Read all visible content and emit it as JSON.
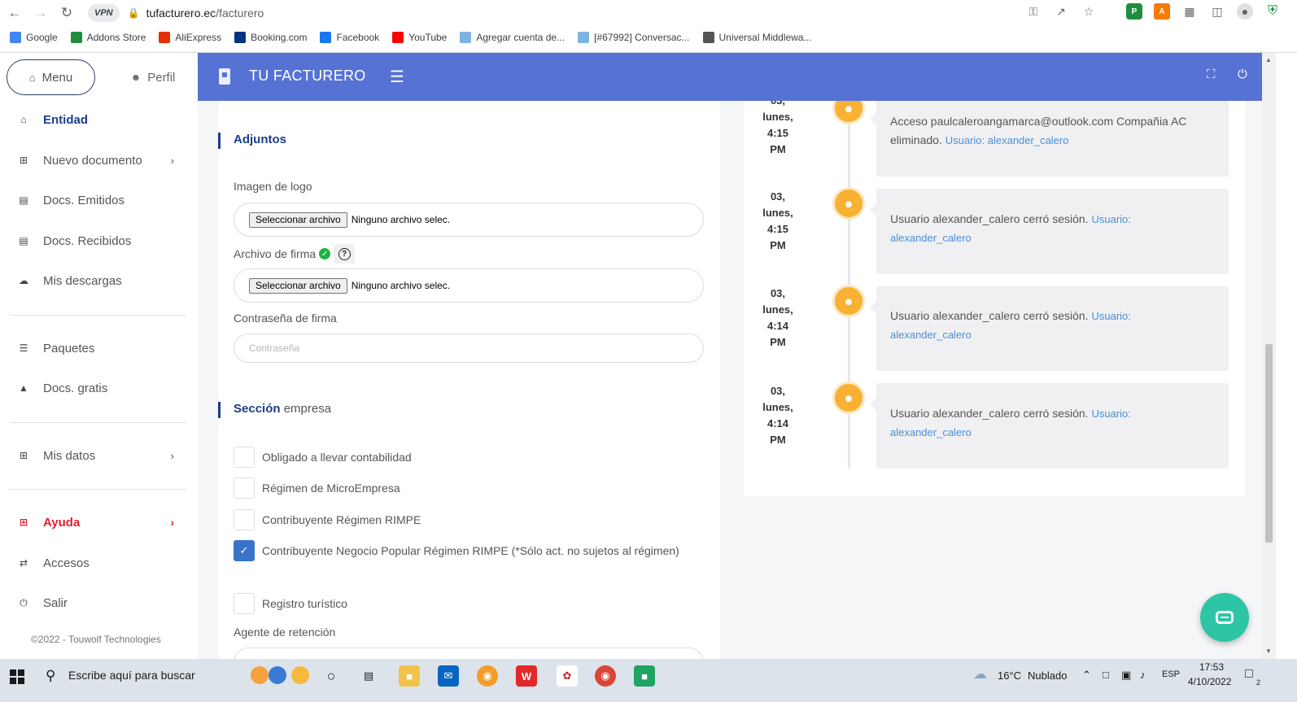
{
  "browser": {
    "vpn": "VPN",
    "url_host": "tufacturero.ec",
    "url_path": "/facturero",
    "bookmarks": [
      {
        "label": "Google",
        "icon": "google-icon",
        "color": "#4285f4"
      },
      {
        "label": "Addons Store",
        "icon": "addons-icon",
        "color": "#1e8e3e"
      },
      {
        "label": "AliExpress",
        "icon": "aliexpress-icon",
        "color": "#e62e04"
      },
      {
        "label": "Booking.com",
        "icon": "booking-icon",
        "color": "#003580"
      },
      {
        "label": "Facebook",
        "icon": "facebook-icon",
        "color": "#1877f2"
      },
      {
        "label": "YouTube",
        "icon": "youtube-icon",
        "color": "#ff0000"
      },
      {
        "label": "Agregar cuenta de...",
        "icon": "bird-icon",
        "color": "#7fb2e5"
      },
      {
        "label": "[#67992] Conversac...",
        "icon": "bird-icon",
        "color": "#7fb2e5"
      },
      {
        "label": "Universal Middlewa...",
        "icon": "globe-icon",
        "color": "#555555"
      }
    ]
  },
  "sidebar": {
    "menu_label": "Menu",
    "perfil_label": "Perfil",
    "items": [
      {
        "label": "Entidad",
        "icon": "home-icon"
      },
      {
        "label": "Nuevo documento",
        "icon": "plus-square-icon"
      },
      {
        "label": "Docs. Emitidos",
        "icon": "clipboard-icon"
      },
      {
        "label": "Docs. Recibidos",
        "icon": "clipboard-icon"
      },
      {
        "label": "Mis descargas",
        "icon": "cloud-download-icon"
      },
      {
        "label": "Paquetes",
        "icon": "columns-icon"
      },
      {
        "label": "Docs. gratis",
        "icon": "cake-icon"
      },
      {
        "label": "Mis datos",
        "icon": "plus-square-icon"
      },
      {
        "label": "Ayuda",
        "icon": "plus-square-icon"
      },
      {
        "label": "Accesos",
        "icon": "exchange-icon"
      },
      {
        "label": "Salir",
        "icon": "power-icon"
      }
    ],
    "copyright": "©2022 - Touwolf Technologies"
  },
  "header": {
    "brand": "TU FACTURERO"
  },
  "form": {
    "adjuntos_title": "Adjuntos",
    "logo_label": "Imagen de logo",
    "file_button": "Seleccionar archivo",
    "file_none": "Ninguno archivo selec.",
    "firma_label": "Archivo de firma",
    "firma_help": "?",
    "password_label": "Contraseña de firma",
    "password_placeholder": "Contraseña",
    "seccion_bold": "Sección",
    "seccion_light": "empresa",
    "checkboxes": [
      {
        "label": "Obligado a llevar contabilidad",
        "checked": false
      },
      {
        "label": "Régimen de MicroEmpresa",
        "checked": false
      },
      {
        "label": "Contribuyente Régimen RIMPE",
        "checked": false
      },
      {
        "label": "Contribuyente Negocio Popular Régimen RIMPE (*Sólo act. no sujetos al régimen)",
        "checked": true
      },
      {
        "label": "Registro turístico",
        "checked": false
      }
    ],
    "agente_label": "Agente de retención"
  },
  "timeline": [
    {
      "day": "03,",
      "weekday": "lunes,",
      "time": "4:15",
      "ampm": "PM",
      "text": "Acceso paulcaleroangamarca@outlook.com Compañia AC eliminado.",
      "user": "Usuario: alexander_calero"
    },
    {
      "day": "03,",
      "weekday": "lunes,",
      "time": "4:15",
      "ampm": "PM",
      "text": "Usuario alexander_calero cerró sesión.",
      "user": "Usuario: alexander_calero"
    },
    {
      "day": "03,",
      "weekday": "lunes,",
      "time": "4:14",
      "ampm": "PM",
      "text": "Usuario alexander_calero cerró sesión.",
      "user": "Usuario: alexander_calero"
    },
    {
      "day": "03,",
      "weekday": "lunes,",
      "time": "4:14",
      "ampm": "PM",
      "text": "Usuario alexander_calero cerró sesión.",
      "user": "Usuario: alexander_calero"
    }
  ],
  "taskbar": {
    "search_placeholder": "Escribe aquí para buscar",
    "weather_temp": "16°C",
    "weather_desc": "Nublado",
    "lang": "ESP",
    "time": "17:53",
    "date": "4/10/2022",
    "notif_count": "2"
  }
}
